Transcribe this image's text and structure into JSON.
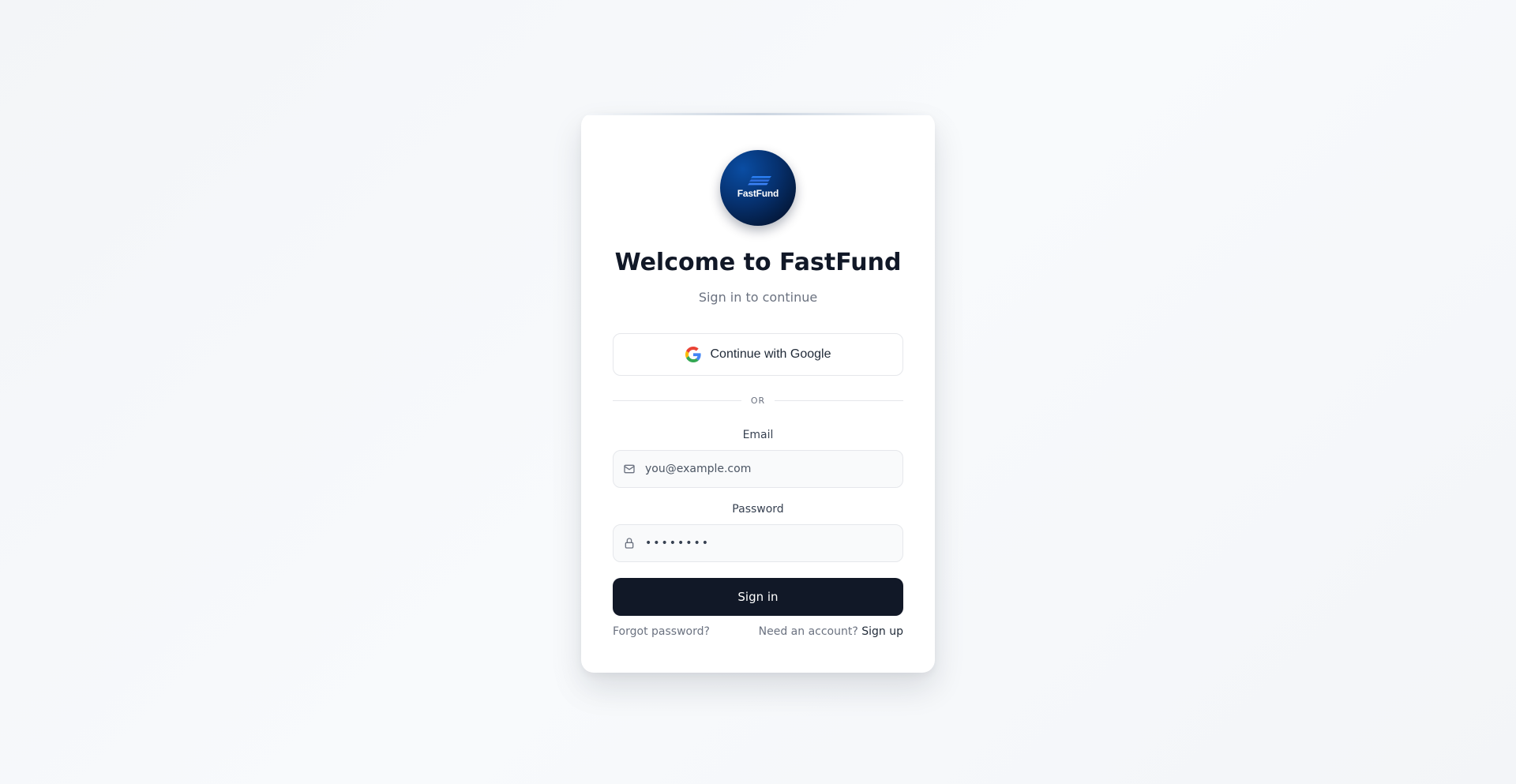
{
  "brand": {
    "logo_text": "FastFund",
    "colors": {
      "primary_dark": "#111827",
      "logo_blue": "#06316f",
      "stripe_blue": "#2a7df0"
    }
  },
  "header": {
    "title": "Welcome to FastFund",
    "subtitle": "Sign in to continue"
  },
  "oauth": {
    "google_label": "Continue with Google",
    "icon": "google-icon"
  },
  "divider": {
    "text": "OR"
  },
  "form": {
    "email": {
      "label": "Email",
      "placeholder": "you@example.com",
      "value": "",
      "icon": "mail-icon"
    },
    "password": {
      "label": "Password",
      "value": "••••••••",
      "icon": "lock-icon"
    },
    "submit_label": "Sign in"
  },
  "footer": {
    "forgot_label": "Forgot password?",
    "need_account_label": "Need an account?",
    "signup_label": "Sign up"
  }
}
